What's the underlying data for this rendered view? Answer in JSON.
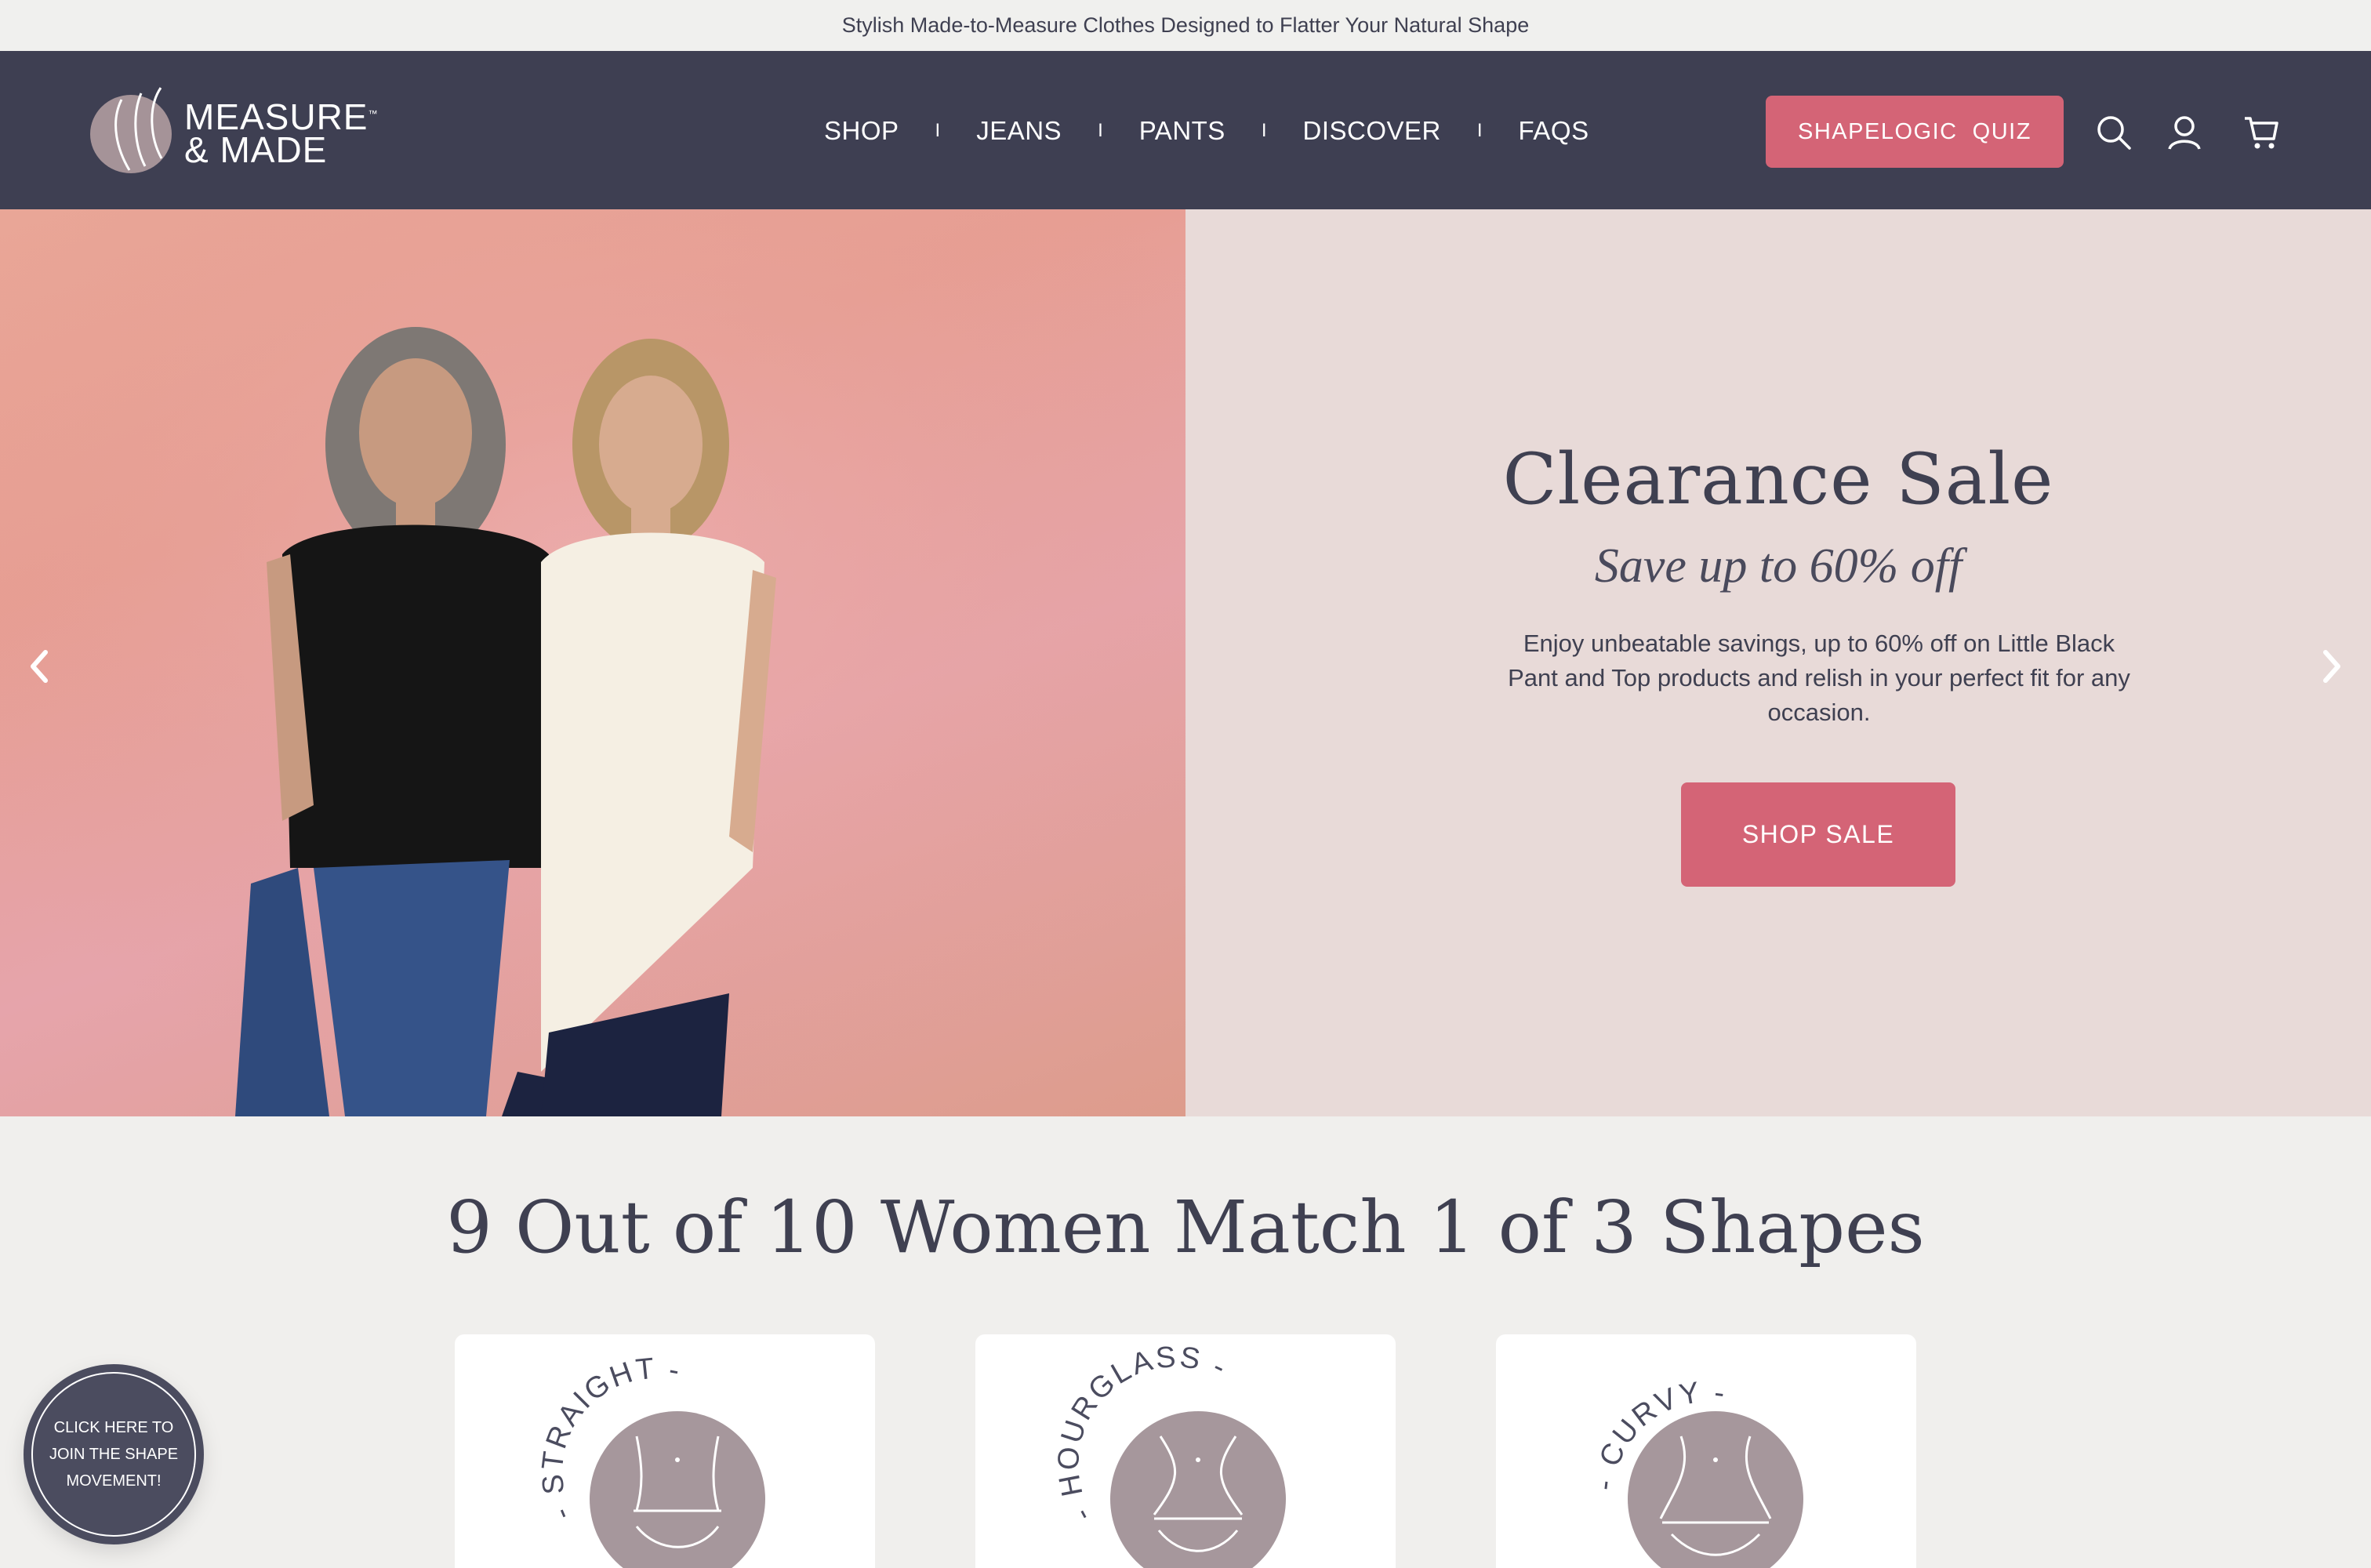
{
  "announcement": "Stylish Made-to-Measure Clothes Designed to Flatter Your Natural Shape",
  "header": {
    "logo_line1": "MEASURE",
    "logo_tm": "™",
    "logo_line2": "& MADE",
    "nav": [
      "SHOP",
      "JEANS",
      "PANTS",
      "DISCOVER",
      "FAQS"
    ],
    "nav_separator": "I",
    "quiz_label": "SHAPELOGIC  QUIZ",
    "icons": [
      "search-icon",
      "account-icon",
      "cart-icon"
    ]
  },
  "hero": {
    "title": "Clearance Sale",
    "subtitle": "Save up to 60% off",
    "description": "Enjoy unbeatable savings, up to 60% off on Little Black Pant and Top products and relish in your perfect fit for any occasion.",
    "cta": "SHOP SALE",
    "prev_icon": "chevron-left-icon",
    "next_icon": "chevron-right-icon"
  },
  "shapes": {
    "title": "9 Out of 10 Women Match 1 of 3 Shapes",
    "cards": [
      {
        "label": "- STRAIGHT -"
      },
      {
        "label": "- HOURGLASS -"
      },
      {
        "label": "- CURVY -"
      }
    ]
  },
  "badge": {
    "text": "CLICK HERE TO JOIN THE SHAPE MOVEMENT!"
  },
  "colors": {
    "navy": "#3e3f52",
    "accent": "#d46476",
    "panel": "#e8dad8",
    "shape_circle": "#a6979c",
    "page_bg": "#f0efed"
  }
}
